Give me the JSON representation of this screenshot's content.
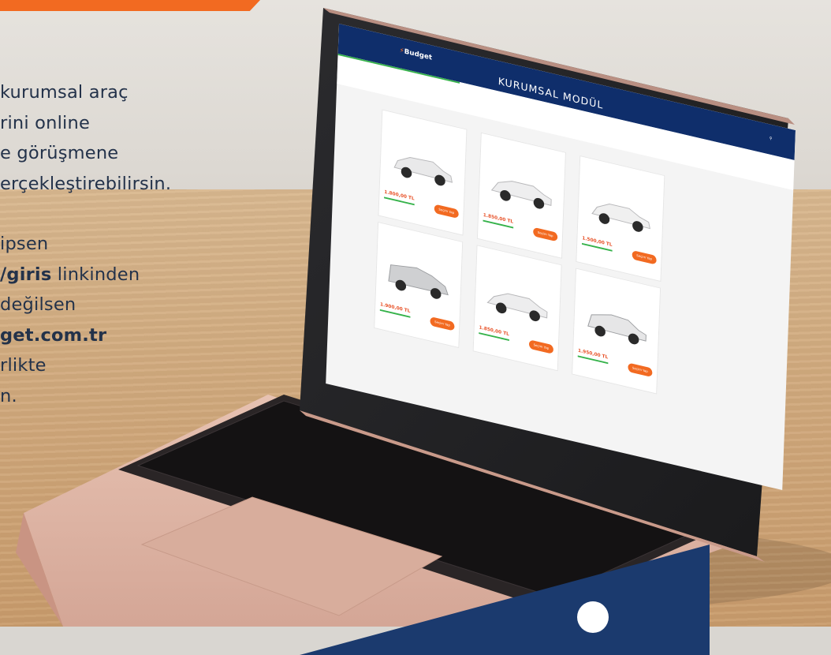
{
  "promo": {
    "lines": [
      "kurumsal araç",
      "rini online",
      "e görüşmene",
      "erçekleştirebilirsin.",
      "ipsen",
      "/giris linkinden",
      "değilsen",
      "get.com.tr",
      "rlikte",
      "n."
    ]
  },
  "screen": {
    "logo": "Budget",
    "title": "KURUMSAL MODÜL",
    "cards": [
      {
        "price": "1.800,00 TL"
      },
      {
        "price": "1.850,00 TL"
      },
      {
        "price": "1.500,00 TL"
      },
      {
        "price": "1.900,00 TL"
      },
      {
        "price": "1.850,00 TL"
      },
      {
        "price": "1.950,00 TL"
      }
    ],
    "select_label": "Seçim Yap"
  },
  "colors": {
    "accent": "#f26a21",
    "navy": "#0f2e6b",
    "text": "#23324a"
  }
}
